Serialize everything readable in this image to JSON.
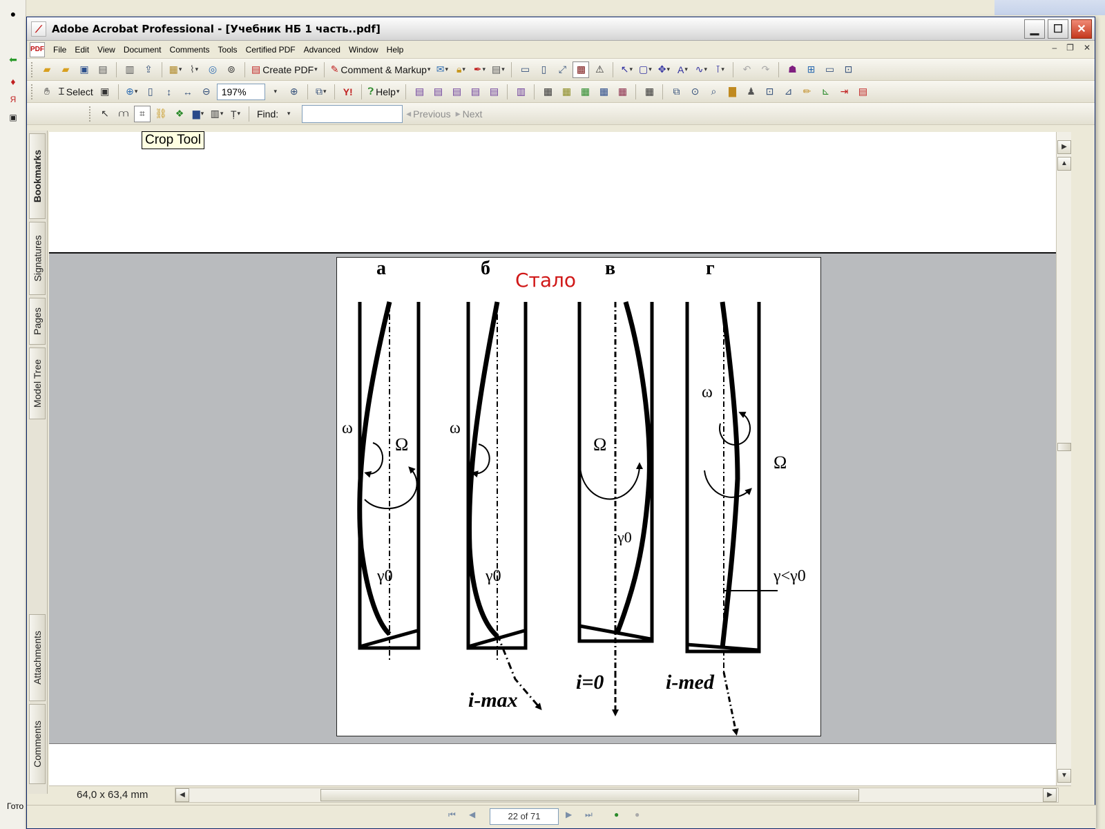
{
  "window": {
    "title": "Adobe Acrobat Professional - [Учебник НБ 1 часть..pdf]"
  },
  "menubar": {
    "items": [
      "File",
      "Edit",
      "View",
      "Document",
      "Comments",
      "Tools",
      "Certified PDF",
      "Advanced",
      "Window",
      "Help"
    ]
  },
  "toolbar1": {
    "create_pdf": "Create PDF",
    "comment_markup": "Comment & Markup"
  },
  "toolbar2": {
    "select": "Select",
    "zoom": "197%",
    "help": "Help"
  },
  "toolbar3": {
    "find_label": "Find:",
    "previous": "Previous",
    "next": "Next"
  },
  "tooltip": {
    "text": "Crop Tool"
  },
  "navigation_tabs": [
    "Bookmarks",
    "Signatures",
    "Pages",
    "Model Tree",
    "Attachments",
    "Comments"
  ],
  "document": {
    "figure": {
      "panel_labels": [
        "а",
        "б",
        "в",
        "г"
      ],
      "stamp": "Стало",
      "omega_small": "ω",
      "omega_large": "Ω",
      "gamma0": "γ0",
      "gamma_compare": "γ<γ0",
      "captions": [
        "i-max",
        "i=0",
        "i-med"
      ]
    }
  },
  "statusbar": {
    "page_size": "64,0 x 63,4 mm",
    "page_indicator": "22 of 71"
  },
  "background_app": {
    "status_text": "Гото"
  }
}
